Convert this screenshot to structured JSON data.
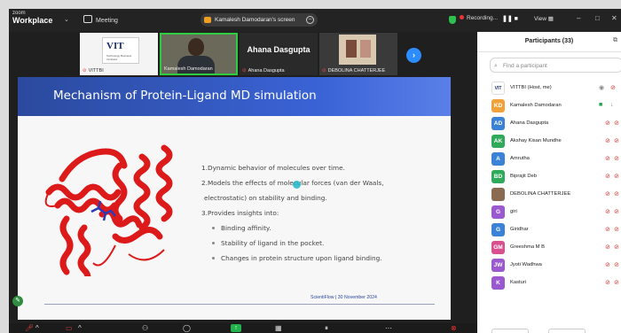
{
  "app": {
    "logo_top": "zoom",
    "logo_bottom": "Workplace",
    "meeting_label": "Meeting"
  },
  "share_pill": {
    "label": "Kamalesh Damodaran's screen"
  },
  "topbar": {
    "recording": "Recording...",
    "pause": "❚❚ ■",
    "view": "View",
    "min": "–",
    "max": "□",
    "close": "✕"
  },
  "thumbnails": [
    {
      "name": "VITTBI",
      "logo_text": "VIT",
      "logo_sub": "Technology Business Incubator"
    },
    {
      "name": "Kamalesh Damodaran"
    },
    {
      "name": "Ahana Dasgupta",
      "big_label": "Ahana Dasgupta"
    },
    {
      "name": "DEBOLINA CHATTERJEE"
    }
  ],
  "slide": {
    "title": "Mechanism of Protein-Ligand MD simulation",
    "points": [
      "1.Dynamic behavior of molecules over time.",
      "2.Models the effects of molecular forces (van der Waals,",
      "electrostatic) on stability and binding.",
      "3.Provides insights into:"
    ],
    "subpoints": [
      "Binding affinity.",
      "Stability of ligand in the pocket.",
      "Changes in protein structure upon ligand binding."
    ],
    "footer": "ScientiFlow | 30 November 2024"
  },
  "participants": {
    "title": "Participants (33)",
    "search_placeholder": "Find a participant",
    "list": [
      {
        "initials": "",
        "name": "VITTBI (Host, me)",
        "color": "#ffffff"
      },
      {
        "initials": "KD",
        "name": "Kamalesh Damodaran",
        "color": "#f0a23a"
      },
      {
        "initials": "AD",
        "name": "Ahana Dasgupta",
        "color": "#3b82d6"
      },
      {
        "initials": "AK",
        "name": "Akshay Kisan Mundhe",
        "color": "#2eaa5a"
      },
      {
        "initials": "A",
        "name": "Amrutha",
        "color": "#3b82d6"
      },
      {
        "initials": "BD",
        "name": "Biprajit Deb",
        "color": "#2eaa5a"
      },
      {
        "initials": "",
        "name": "DEBOLINA CHATTERJEE",
        "color": "#8a6a50"
      },
      {
        "initials": "G",
        "name": "giri",
        "color": "#9b59d0"
      },
      {
        "initials": "G",
        "name": "Giridhar",
        "color": "#3b82d6"
      },
      {
        "initials": "GM",
        "name": "Greeshma M B",
        "color": "#d9508f"
      },
      {
        "initials": "JW",
        "name": "Jyoti Wadhwa",
        "color": "#9b59d0"
      },
      {
        "initials": "K",
        "name": "Kasturi",
        "color": "#9b59d0"
      }
    ]
  },
  "colors": {
    "accent": "#2d8cff",
    "slide_header": "#2b4a9e",
    "protein": "#dd1a1a",
    "ligand": "#2a3ab8",
    "active_speaker": "#2ecc40"
  }
}
